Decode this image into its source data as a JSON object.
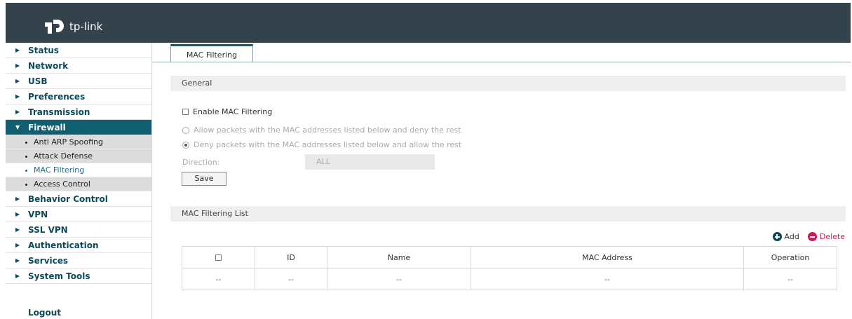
{
  "brand": {
    "logo_text": "tp-link"
  },
  "sidebar": {
    "items": [
      {
        "label": "Status"
      },
      {
        "label": "Network"
      },
      {
        "label": "USB"
      },
      {
        "label": "Preferences"
      },
      {
        "label": "Transmission"
      },
      {
        "label": "Firewall",
        "expanded": true
      },
      {
        "label": "Behavior Control"
      },
      {
        "label": "VPN"
      },
      {
        "label": "SSL VPN"
      },
      {
        "label": "Authentication"
      },
      {
        "label": "Services"
      },
      {
        "label": "System Tools"
      }
    ],
    "firewall_sub": [
      {
        "label": "Anti ARP Spoofing"
      },
      {
        "label": "Attack Defense"
      },
      {
        "label": "MAC Filtering",
        "active": true
      },
      {
        "label": "Access Control"
      }
    ],
    "logout": "Logout"
  },
  "tabs": [
    {
      "label": "MAC Filtering"
    }
  ],
  "general": {
    "title": "General",
    "enable_label": "Enable MAC Filtering",
    "enable_checked": false,
    "option_allow": "Allow packets with the MAC addresses listed below and deny the rest",
    "option_deny": "Deny packets with the MAC addresses listed below and allow the rest",
    "selected_option": "deny",
    "direction_label": "Direction:",
    "direction_value": "ALL",
    "save_label": "Save"
  },
  "list": {
    "title": "MAC Filtering List",
    "add_label": "Add",
    "delete_label": "Delete",
    "columns": [
      "ID",
      "Name",
      "MAC Address",
      "Operation"
    ],
    "rows": [
      {
        "id": "--",
        "name": "--",
        "mac": "--",
        "operation": "--",
        "select": "--"
      }
    ]
  },
  "colors": {
    "header_bg": "#34424b",
    "active_nav": "#0f5f70",
    "add_icon": "#0e4756",
    "delete_icon": "#d0175a"
  }
}
